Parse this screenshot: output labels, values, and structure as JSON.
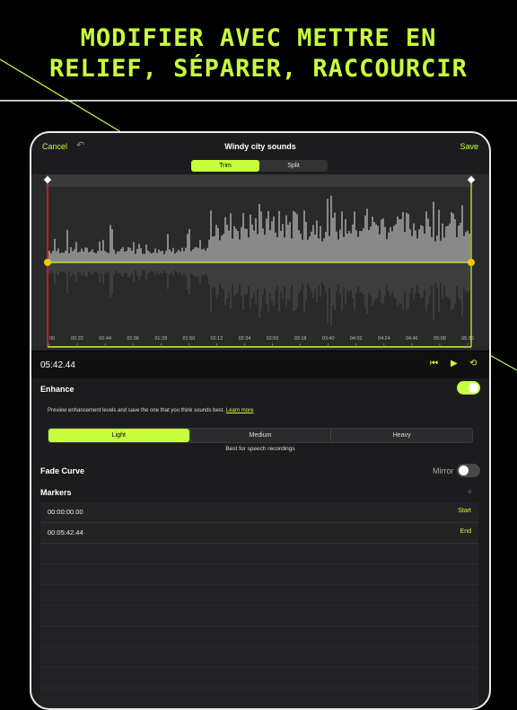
{
  "headline": {
    "line1": "MODIFIER AVEC METTRE EN",
    "line2": "RELIEF, SÉPARER, RACCOURCIR"
  },
  "colors": {
    "accent": "#c8ff3c",
    "trim_start_marker": "#ff2d2d"
  },
  "nav": {
    "cancel": "Cancel",
    "undo_icon": "undo-arrow",
    "title": "Windy city sounds",
    "save": "Save"
  },
  "mode_tabs": [
    {
      "label": "Trim",
      "active": true
    },
    {
      "label": "Split",
      "active": false
    }
  ],
  "timeline": {
    "ticks": [
      "00",
      "00:22",
      "00:44",
      "01:06",
      "01:28",
      "01:50",
      "02:12",
      "02:34",
      "02:56",
      "03:18",
      "03:40",
      "04:02",
      "04:24",
      "04:46",
      "05:08",
      "05:30"
    ]
  },
  "playback": {
    "current_time": "05:42.44",
    "icons": [
      "skip-to-start",
      "play",
      "loop"
    ]
  },
  "enhance": {
    "label": "Enhance",
    "enabled": true,
    "description": "Preview enhancement levels and save the one that you think sounds best.",
    "learn_more": "Learn more",
    "levels": [
      {
        "label": "Light",
        "active": true
      },
      {
        "label": "Medium",
        "active": false
      },
      {
        "label": "Heavy",
        "active": false
      }
    ],
    "level_note": "Best for speech recordings"
  },
  "fade_curve": {
    "label": "Fade Curve",
    "mirror_label": "Mirror",
    "mirror_enabled": false
  },
  "markers": {
    "label": "Markers",
    "add_icon": "plus",
    "items": [
      {
        "time": "00:00:00.00",
        "tag": "Start"
      },
      {
        "time": "00:05:42.44",
        "tag": "End"
      }
    ]
  }
}
